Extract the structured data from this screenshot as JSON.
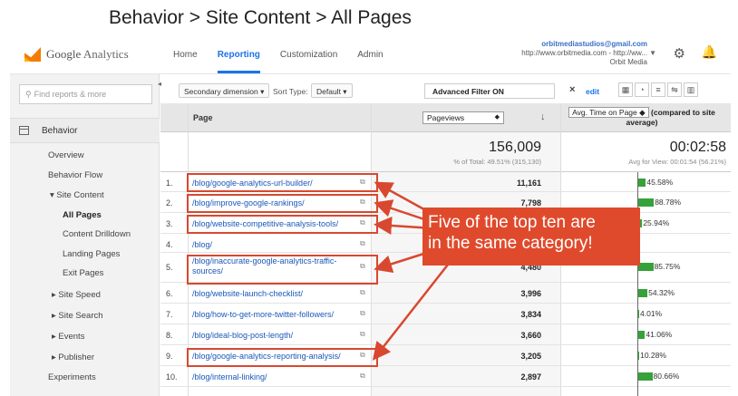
{
  "slide": {
    "title": "Behavior > Site Content > All Pages"
  },
  "header": {
    "logo_google": "Google",
    "logo_analytics": " Analytics",
    "nav": [
      "Home",
      "Reporting",
      "Customization",
      "Admin"
    ],
    "account_email": "orbitmediastudios@gmail.com",
    "account_url": "http://www.orbitmedia.com - http://ww...",
    "account_name": "Orbit Media",
    "settings_icon": "gear-icon",
    "notifications_icon": "bell-icon"
  },
  "sidebar": {
    "search_placeholder": "Find reports & more",
    "section": "Behavior",
    "items": [
      "Overview",
      "Behavior Flow",
      "▾ Site Content",
      "All Pages",
      "Content Drilldown",
      "Landing Pages",
      "Exit Pages",
      "▸ Site Speed",
      "▸ Site Search",
      "▸ Events",
      "▸ Publisher",
      "Experiments"
    ]
  },
  "toolbar": {
    "secondary_dimension": "Secondary dimension",
    "sort_type_label": "Sort Type:",
    "sort_type_value": "Default",
    "filter_label": "Advanced Filter ON",
    "filter_clear": "×",
    "filter_edit": "edit"
  },
  "table": {
    "page_header": "Page",
    "metric1": "Pageviews",
    "metric2": "Avg. Time on Page",
    "compare_suffix": "(compared to site average)",
    "total_pageviews": "156,009",
    "total_pageviews_sub": "% of Total: 49.51% (315,130)",
    "total_time": "00:02:58",
    "total_time_sub": "Avg for View: 00:01:54 (56.21%)",
    "rows": [
      {
        "n": "1.",
        "page": "/blog/google-analytics-url-builder/",
        "pv": "11,161",
        "pct": "45.58%",
        "val": 45.58
      },
      {
        "n": "2.",
        "page": "/blog/improve-google-rankings/",
        "pv": "7,798",
        "pct": "88.78%",
        "val": 88.78
      },
      {
        "n": "3.",
        "page": "/blog/website-competitive-analysis-tools/",
        "pv": "",
        "pct": "25.94%",
        "val": 25.94
      },
      {
        "n": "4.",
        "page": "/blog/",
        "pv": "",
        "pct": "",
        "val": 0
      },
      {
        "n": "5.",
        "page": "/blog/inaccurate-google-analytics-traffic-sources/",
        "pv": "4,480",
        "pct": "85.75%",
        "val": 85.75
      },
      {
        "n": "6.",
        "page": "/blog/website-launch-checklist/",
        "pv": "3,996",
        "pct": "54.32%",
        "val": 54.32
      },
      {
        "n": "7.",
        "page": "/blog/how-to-get-more-twitter-followers/",
        "pv": "3,834",
        "pct": "4.01%",
        "val": 4.01
      },
      {
        "n": "8.",
        "page": "/blog/ideal-blog-post-length/",
        "pv": "3,660",
        "pct": "41.06%",
        "val": 41.06
      },
      {
        "n": "9.",
        "page": "/blog/google-analytics-reporting-analysis/",
        "pv": "3,205",
        "pct": "10.28%",
        "val": 10.28
      },
      {
        "n": "10.",
        "page": "/blog/internal-linking/",
        "pv": "2,897",
        "pct": "80.66%",
        "val": 80.66
      }
    ]
  },
  "callout": {
    "line1": "Five of the top ten are",
    "line2": "in the same category!",
    "color": "#e04a2c"
  },
  "colors": {
    "accent": "#1a73e8",
    "bar": "#36a23a",
    "highlight": "#d84830"
  }
}
